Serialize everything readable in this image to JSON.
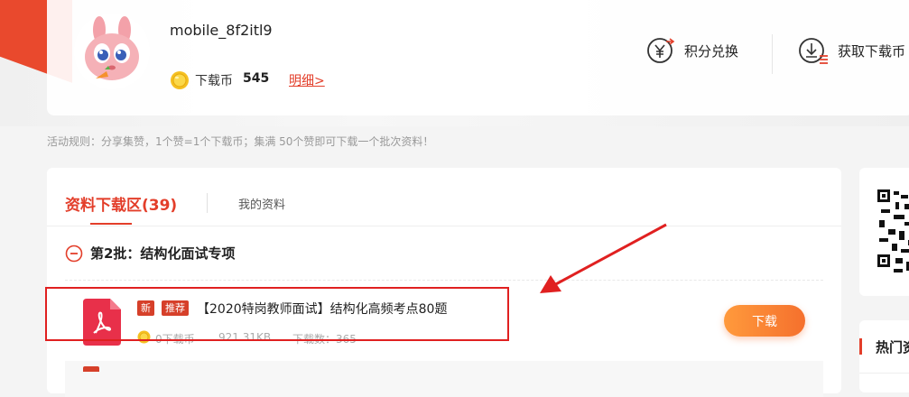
{
  "profile": {
    "username": "mobile_8f2itl9",
    "coin_label": "下载币",
    "coin_value": "545",
    "detail_link": "明细>",
    "exchange_label": "积分兑换",
    "get_coin_label": "获取下载币"
  },
  "rules_text": "活动规则：分享集赞，1个赞=1个下载币；集满 50个赞即可下载一个批次资料！",
  "tabs": {
    "active": "资料下载区(39)",
    "inactive": "我的资料"
  },
  "batch": {
    "title": "第2批：结构化面试专项"
  },
  "file": {
    "badge_new": "新",
    "badge_recommend": "推荐",
    "title": "【2020特岗教师面试】结构化高频考点80题",
    "coins": "0下载币",
    "size": "921.31KB",
    "downloads": "下载数：365",
    "download_button": "下载"
  },
  "sidebar": {
    "hot_title": "热门资"
  },
  "colors": {
    "accent": "#e33e2a",
    "button_start": "#ff9a3c",
    "button_end": "#f5702d",
    "annotation": "#e02020"
  }
}
